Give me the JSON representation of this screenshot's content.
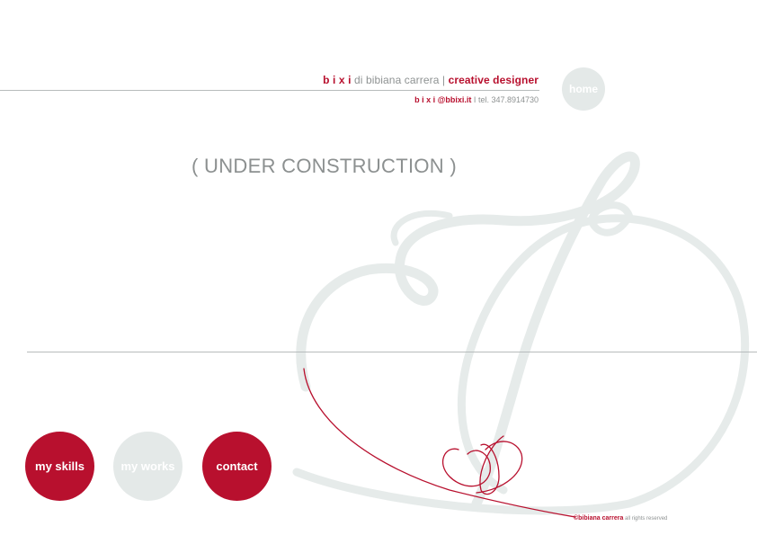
{
  "header": {
    "brand": "b i x i",
    "byline": " di bibiana carrera | ",
    "role": "creative designer",
    "email": "b i x i @bbixi.it",
    "separator": "  I  ",
    "phone": "tel. 347.8914730"
  },
  "nav": {
    "home_label": "home",
    "skills_label": "my skills",
    "works_label": "my works",
    "contact_label": "contact"
  },
  "main": {
    "status": "( UNDER CONSTRUCTION )"
  },
  "footer": {
    "owner": "©bibiana carrera",
    "rights": " all rights reserved"
  },
  "colors": {
    "accent": "#b8102e",
    "muted": "#e4e9e8",
    "text_gray": "#8e9292"
  }
}
